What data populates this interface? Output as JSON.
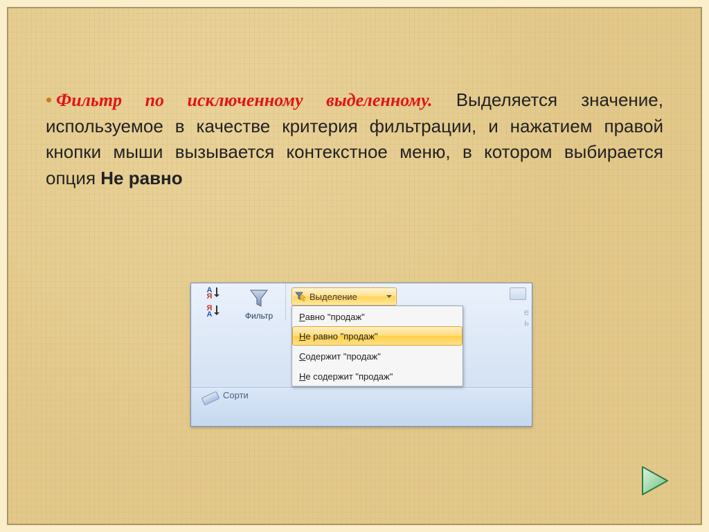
{
  "text": {
    "title": "Фильтр по исключенному выделенному.",
    "body1": " Выделяется значение, используемое в качестве критерия фильтрации, и нажатием правой кнопки мыши вызывается контекстное меню, в котором выбирается опция ",
    "bold_option": "Не равно"
  },
  "ribbon": {
    "filter_label": "Фильтр",
    "section_label": "Сорти",
    "selection_button": "Выделение",
    "right_edge_letter_1": "е",
    "right_edge_letter_2": "ь",
    "menu": {
      "item1_pre": "Р",
      "item1_post": "авно \"продаж\"",
      "item2_pre": "Н",
      "item2_post": "е равно \"продаж\"",
      "item3_pre": "С",
      "item3_post": "одержит \"продаж\"",
      "item4_pre": "Н",
      "item4_post": "е содержит \"продаж\""
    }
  }
}
